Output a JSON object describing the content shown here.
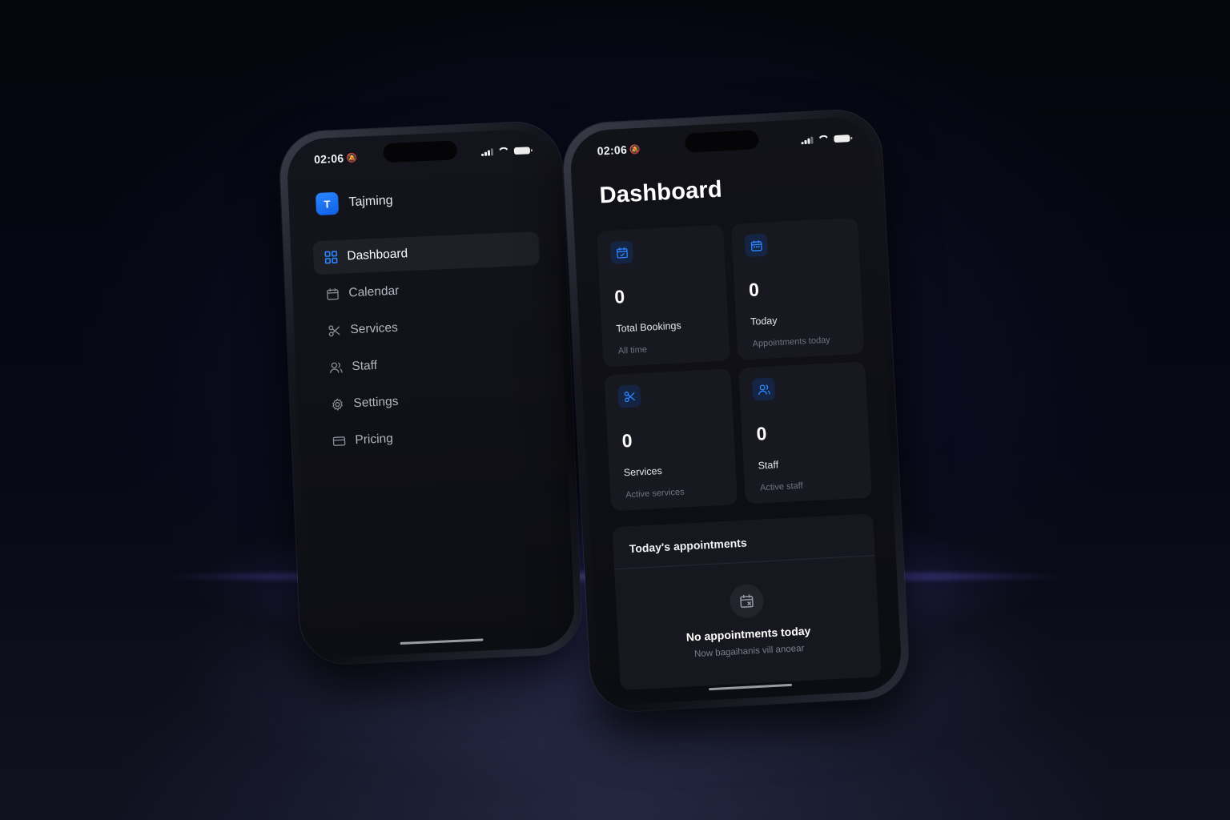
{
  "left_phone": {
    "status_time": "02:06",
    "brand": {
      "logo_letter": "T",
      "name": "Tajming"
    },
    "nav": [
      {
        "label": "Dashboard",
        "icon": "grid-icon",
        "active": true
      },
      {
        "label": "Calendar",
        "icon": "calendar-icon",
        "active": false
      },
      {
        "label": "Services",
        "icon": "scissors-icon",
        "active": false
      },
      {
        "label": "Staff",
        "icon": "users-icon",
        "active": false
      },
      {
        "label": "Settings",
        "icon": "gear-icon",
        "active": false
      },
      {
        "label": "Pricing",
        "icon": "credit-card-icon",
        "active": false
      }
    ]
  },
  "right_phone": {
    "status_time": "02:06",
    "title": "Dashboard",
    "cards": [
      {
        "value": "0",
        "label": "Total Bookings",
        "sub": "All time",
        "icon": "calendar-check-icon"
      },
      {
        "value": "0",
        "label": "Today",
        "sub": "Appointments today",
        "icon": "calendar-day-icon"
      },
      {
        "value": "0",
        "label": "Services",
        "sub": "Active services",
        "icon": "scissors-icon"
      },
      {
        "value": "0",
        "label": "Staff",
        "sub": "Active staff",
        "icon": "users-icon"
      }
    ],
    "appointments": {
      "title": "Today's appointments",
      "empty_title": "No appointments today",
      "empty_sub": "Now bagaihanis vill anoear",
      "empty_icon": "calendar-x-icon"
    }
  },
  "colors": {
    "accent": "#1f7bff",
    "background": "#04040b",
    "glow": "#6a63e6"
  }
}
